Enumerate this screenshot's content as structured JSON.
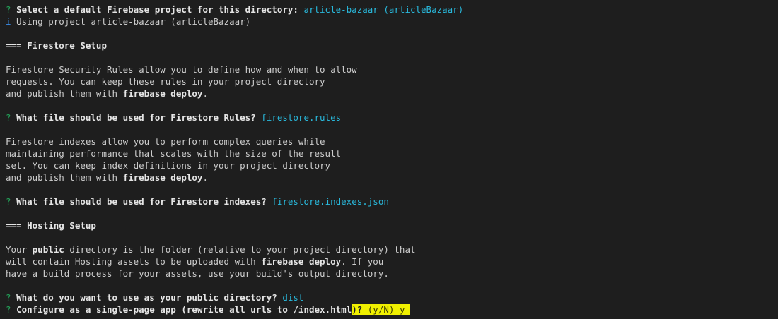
{
  "terminal": {
    "lines": {
      "l1": {
        "prompt_mark": "?",
        "question": "Select a default Firebase project for this directory:",
        "answer": "article-bazaar (articleBazaar)"
      },
      "l2": {
        "info_mark": "i",
        "text": " Using project article-bazaar (articleBazaar)"
      },
      "l3": {
        "text": "=== Firestore Setup"
      },
      "l4": {
        "text": "Firestore Security Rules allow you to define how and when to allow"
      },
      "l5": {
        "text": "requests. You can keep these rules in your project directory"
      },
      "l6": {
        "pre": "and publish them with ",
        "bold": "firebase deploy",
        "post": "."
      },
      "l7": {
        "prompt_mark": "?",
        "question": "What file should be used for Firestore Rules?",
        "answer": "firestore.rules"
      },
      "l8": {
        "text": "Firestore indexes allow you to perform complex queries while"
      },
      "l9": {
        "text": "maintaining performance that scales with the size of the result"
      },
      "l10": {
        "text": "set. You can keep index definitions in your project directory"
      },
      "l11": {
        "pre": "and publish them with ",
        "bold": "firebase deploy",
        "post": "."
      },
      "l12": {
        "prompt_mark": "?",
        "question": "What file should be used for Firestore indexes?",
        "answer": "firestore.indexes.json"
      },
      "l13": {
        "text": "=== Hosting Setup"
      },
      "l14": {
        "pre": "Your ",
        "bold": "public",
        "post": " directory is the folder (relative to your project directory) that"
      },
      "l15": {
        "pre": "will contain Hosting assets to be uploaded with ",
        "bold": "firebase deploy",
        "post": ". If you"
      },
      "l16": {
        "text": "have a build process for your assets, use your build's output directory."
      },
      "l17": {
        "prompt_mark": "?",
        "question": "What do you want to use as your public directory?",
        "answer": "dist"
      },
      "l18": {
        "prompt_mark": "?",
        "question_main": "Configure as a single-page app (rewrite all urls to /index.html",
        "question_tail": ")?",
        "hint": " (y/N) ",
        "typed": "y"
      }
    }
  },
  "colors": {
    "background": "#1e1e1e",
    "prompt_mark": "#23a55a",
    "answer": "#29b8db",
    "info": "#3b8eea",
    "highlight": "#f0f000"
  }
}
